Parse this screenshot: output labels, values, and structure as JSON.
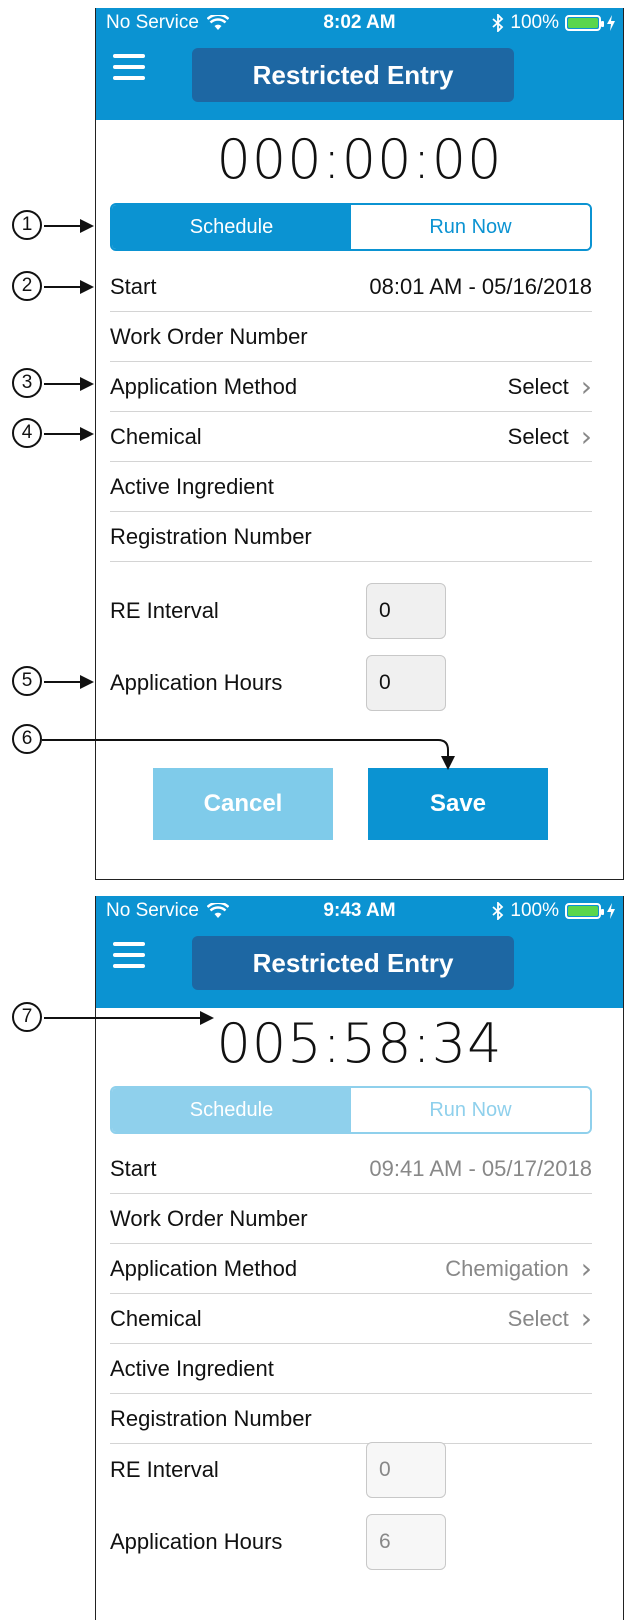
{
  "screens": [
    {
      "status": {
        "carrier": "No Service",
        "time": "8:02 AM",
        "battery": "100%"
      },
      "nav_title": "Restricted Entry",
      "timer": "000:00:00",
      "segment": {
        "schedule": "Schedule",
        "run_now": "Run Now"
      },
      "rows": {
        "start_label": "Start",
        "start_value": "08:01 AM - 05/16/2018",
        "work_order_label": "Work Order Number",
        "method_label": "Application Method",
        "method_value": "Select",
        "chemical_label": "Chemical",
        "chemical_value": "Select",
        "ingredient_label": "Active Ingredient",
        "registration_label": "Registration Number"
      },
      "fields": {
        "re_interval_label": "RE Interval",
        "re_interval_value": "0",
        "app_hours_label": "Application Hours",
        "app_hours_value": "0"
      },
      "buttons": {
        "cancel": "Cancel",
        "save": "Save"
      }
    },
    {
      "status": {
        "carrier": "No Service",
        "time": "9:43 AM",
        "battery": "100%"
      },
      "nav_title": "Restricted Entry",
      "timer": "005:58:34",
      "segment": {
        "schedule": "Schedule",
        "run_now": "Run Now"
      },
      "rows": {
        "start_label": "Start",
        "start_value": "09:41 AM - 05/17/2018",
        "work_order_label": "Work Order Number",
        "method_label": "Application Method",
        "method_value": "Chemigation",
        "chemical_label": "Chemical",
        "chemical_value": "Select",
        "ingredient_label": "Active Ingredient",
        "registration_label": "Registration Number"
      },
      "fields": {
        "re_interval_label": "RE Interval",
        "re_interval_value": "0",
        "app_hours_label": "Application Hours",
        "app_hours_value": "6"
      }
    }
  ],
  "callouts": [
    "1",
    "2",
    "3",
    "4",
    "5",
    "6",
    "7"
  ],
  "colors": {
    "accent": "#0b93d2",
    "title_pill": "#1d67a3",
    "cancel_bg": "#7fcbea",
    "battery_fill": "#5ad64c"
  },
  "icons": [
    "wifi-icon",
    "bluetooth-icon",
    "battery-icon",
    "charging-icon",
    "hamburger-menu-icon",
    "chevron-right-icon"
  ]
}
